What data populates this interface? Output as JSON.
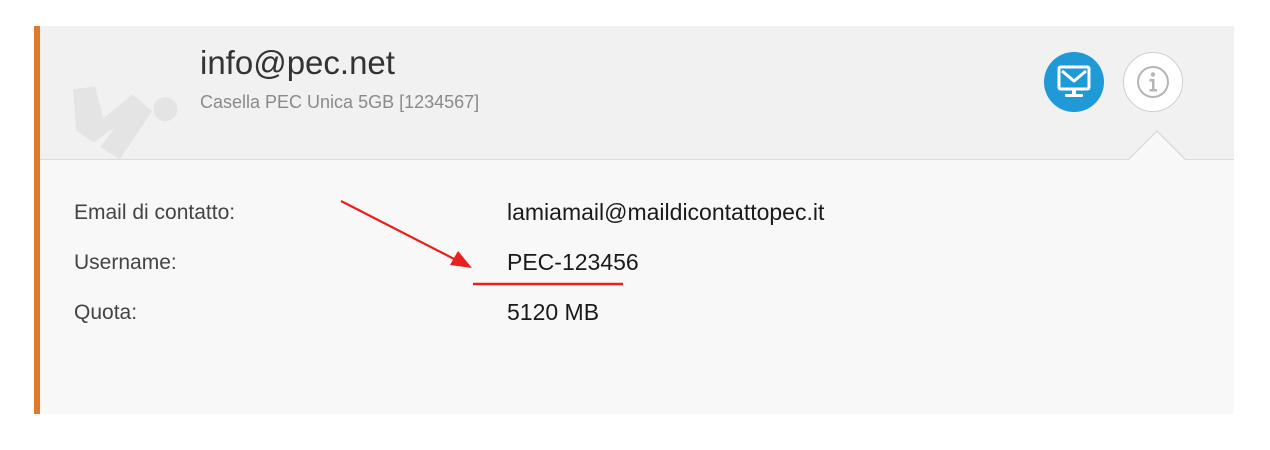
{
  "account": {
    "email": "info@pec.net",
    "subtitle": "Casella PEC Unica 5GB [1234567]"
  },
  "icons": {
    "mail_button": "monitor-mail-icon",
    "info_button": "info-icon",
    "watermark": "brand-logo-watermark"
  },
  "details": [
    {
      "label": "Email di contatto:",
      "value": "lamiamail@maildicontattopec.it"
    },
    {
      "label": "Username:",
      "value": "PEC-123456"
    },
    {
      "label": "Quota:",
      "value": "5120 MB"
    }
  ],
  "colors": {
    "accent_border": "#e07a2a",
    "mail_button": "#1f9ad6",
    "annotation": "#e8201e"
  }
}
